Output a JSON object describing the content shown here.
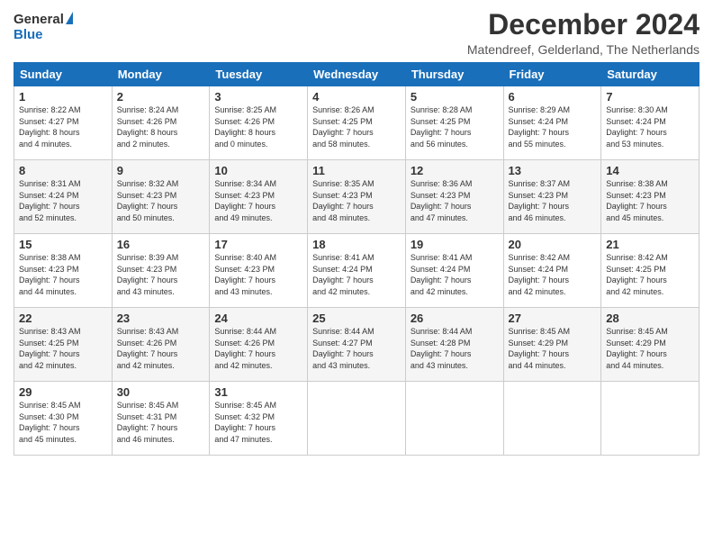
{
  "logo": {
    "general": "General",
    "blue": "Blue"
  },
  "title": "December 2024",
  "location": "Matendreef, Gelderland, The Netherlands",
  "days_header": [
    "Sunday",
    "Monday",
    "Tuesday",
    "Wednesday",
    "Thursday",
    "Friday",
    "Saturday"
  ],
  "weeks": [
    [
      {
        "day": "1",
        "info": "Sunrise: 8:22 AM\nSunset: 4:27 PM\nDaylight: 8 hours\nand 4 minutes."
      },
      {
        "day": "2",
        "info": "Sunrise: 8:24 AM\nSunset: 4:26 PM\nDaylight: 8 hours\nand 2 minutes."
      },
      {
        "day": "3",
        "info": "Sunrise: 8:25 AM\nSunset: 4:26 PM\nDaylight: 8 hours\nand 0 minutes."
      },
      {
        "day": "4",
        "info": "Sunrise: 8:26 AM\nSunset: 4:25 PM\nDaylight: 7 hours\nand 58 minutes."
      },
      {
        "day": "5",
        "info": "Sunrise: 8:28 AM\nSunset: 4:25 PM\nDaylight: 7 hours\nand 56 minutes."
      },
      {
        "day": "6",
        "info": "Sunrise: 8:29 AM\nSunset: 4:24 PM\nDaylight: 7 hours\nand 55 minutes."
      },
      {
        "day": "7",
        "info": "Sunrise: 8:30 AM\nSunset: 4:24 PM\nDaylight: 7 hours\nand 53 minutes."
      }
    ],
    [
      {
        "day": "8",
        "info": "Sunrise: 8:31 AM\nSunset: 4:24 PM\nDaylight: 7 hours\nand 52 minutes."
      },
      {
        "day": "9",
        "info": "Sunrise: 8:32 AM\nSunset: 4:23 PM\nDaylight: 7 hours\nand 50 minutes."
      },
      {
        "day": "10",
        "info": "Sunrise: 8:34 AM\nSunset: 4:23 PM\nDaylight: 7 hours\nand 49 minutes."
      },
      {
        "day": "11",
        "info": "Sunrise: 8:35 AM\nSunset: 4:23 PM\nDaylight: 7 hours\nand 48 minutes."
      },
      {
        "day": "12",
        "info": "Sunrise: 8:36 AM\nSunset: 4:23 PM\nDaylight: 7 hours\nand 47 minutes."
      },
      {
        "day": "13",
        "info": "Sunrise: 8:37 AM\nSunset: 4:23 PM\nDaylight: 7 hours\nand 46 minutes."
      },
      {
        "day": "14",
        "info": "Sunrise: 8:38 AM\nSunset: 4:23 PM\nDaylight: 7 hours\nand 45 minutes."
      }
    ],
    [
      {
        "day": "15",
        "info": "Sunrise: 8:38 AM\nSunset: 4:23 PM\nDaylight: 7 hours\nand 44 minutes."
      },
      {
        "day": "16",
        "info": "Sunrise: 8:39 AM\nSunset: 4:23 PM\nDaylight: 7 hours\nand 43 minutes."
      },
      {
        "day": "17",
        "info": "Sunrise: 8:40 AM\nSunset: 4:23 PM\nDaylight: 7 hours\nand 43 minutes."
      },
      {
        "day": "18",
        "info": "Sunrise: 8:41 AM\nSunset: 4:24 PM\nDaylight: 7 hours\nand 42 minutes."
      },
      {
        "day": "19",
        "info": "Sunrise: 8:41 AM\nSunset: 4:24 PM\nDaylight: 7 hours\nand 42 minutes."
      },
      {
        "day": "20",
        "info": "Sunrise: 8:42 AM\nSunset: 4:24 PM\nDaylight: 7 hours\nand 42 minutes."
      },
      {
        "day": "21",
        "info": "Sunrise: 8:42 AM\nSunset: 4:25 PM\nDaylight: 7 hours\nand 42 minutes."
      }
    ],
    [
      {
        "day": "22",
        "info": "Sunrise: 8:43 AM\nSunset: 4:25 PM\nDaylight: 7 hours\nand 42 minutes."
      },
      {
        "day": "23",
        "info": "Sunrise: 8:43 AM\nSunset: 4:26 PM\nDaylight: 7 hours\nand 42 minutes."
      },
      {
        "day": "24",
        "info": "Sunrise: 8:44 AM\nSunset: 4:26 PM\nDaylight: 7 hours\nand 42 minutes."
      },
      {
        "day": "25",
        "info": "Sunrise: 8:44 AM\nSunset: 4:27 PM\nDaylight: 7 hours\nand 43 minutes."
      },
      {
        "day": "26",
        "info": "Sunrise: 8:44 AM\nSunset: 4:28 PM\nDaylight: 7 hours\nand 43 minutes."
      },
      {
        "day": "27",
        "info": "Sunrise: 8:45 AM\nSunset: 4:29 PM\nDaylight: 7 hours\nand 44 minutes."
      },
      {
        "day": "28",
        "info": "Sunrise: 8:45 AM\nSunset: 4:29 PM\nDaylight: 7 hours\nand 44 minutes."
      }
    ],
    [
      {
        "day": "29",
        "info": "Sunrise: 8:45 AM\nSunset: 4:30 PM\nDaylight: 7 hours\nand 45 minutes."
      },
      {
        "day": "30",
        "info": "Sunrise: 8:45 AM\nSunset: 4:31 PM\nDaylight: 7 hours\nand 46 minutes."
      },
      {
        "day": "31",
        "info": "Sunrise: 8:45 AM\nSunset: 4:32 PM\nDaylight: 7 hours\nand 47 minutes."
      },
      {
        "day": "",
        "info": ""
      },
      {
        "day": "",
        "info": ""
      },
      {
        "day": "",
        "info": ""
      },
      {
        "day": "",
        "info": ""
      }
    ]
  ]
}
